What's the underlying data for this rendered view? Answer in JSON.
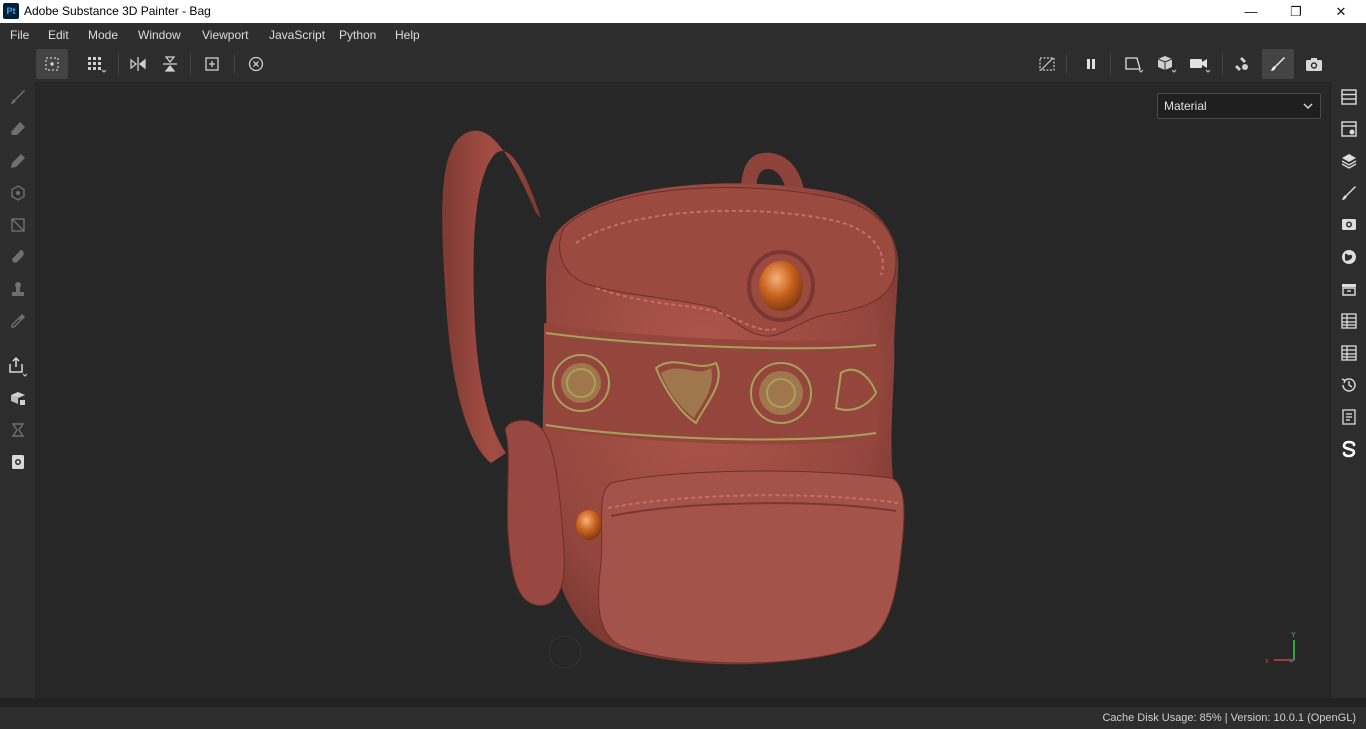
{
  "app": {
    "icon_label": "Pt",
    "title": "Adobe Substance 3D Painter - Bag"
  },
  "window_controls": {
    "minimize": "—",
    "restore": "❐",
    "close": "✕"
  },
  "menu": [
    "File",
    "Edit",
    "Mode",
    "Window",
    "Viewport",
    "JavaScript",
    "Python",
    "Help"
  ],
  "toolbar": {
    "left_icons": [
      "symmetry-grid-icon",
      "grid-options-icon",
      "mirror-x-icon",
      "mirror-y-icon",
      "frame-selection-icon",
      "reset-view-icon"
    ],
    "right_icons": [
      "hide-overlay-icon",
      "pause-icon",
      "camera-perspective-icon",
      "display-mode-icon",
      "camera-icon",
      "bake-icon",
      "paint-mode-icon",
      "screenshot-icon"
    ]
  },
  "left_tools": [
    "paint-icon",
    "eraser-icon",
    "projection-icon",
    "polygon-fill-icon",
    "geometry-mask-icon",
    "smudge-icon",
    "clone-icon",
    "color-picker-icon",
    "export-icon",
    "bake-mesh-icon",
    "material-hourglass-icon",
    "viewer-icon"
  ],
  "right_panels": [
    "texture-set-list-icon",
    "texture-set-settings-icon",
    "layers-icon",
    "properties-icon",
    "display-settings-icon",
    "environment-icon",
    "assets-icon",
    "shader-settings-icon",
    "history-list-icon",
    "history-icon",
    "log-icon",
    "substance-logo-icon"
  ],
  "viewport": {
    "channel_dropdown": "Material",
    "axis": {
      "x_label": "x",
      "y_label": "Y"
    },
    "bag_color": "#a14d44",
    "embroidery_color": "#a9a05a",
    "button_color": "#c8631f"
  },
  "status": {
    "text": "Cache Disk Usage:   85% | Version: 10.0.1 (OpenGL)"
  }
}
